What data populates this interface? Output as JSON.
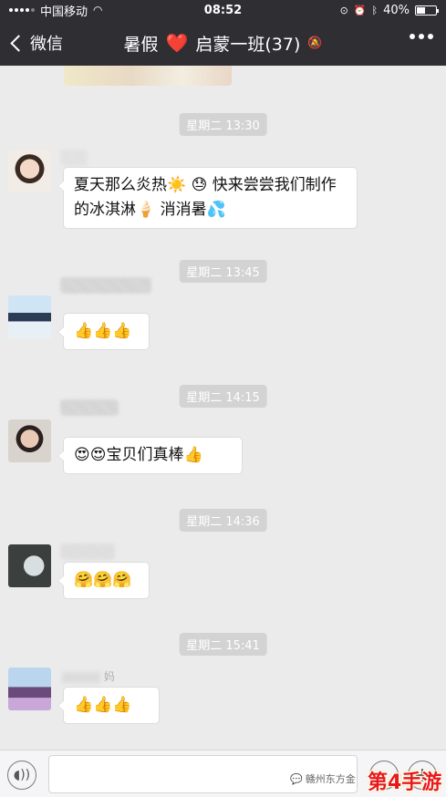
{
  "statusbar": {
    "carrier": "中国移动",
    "time": "08:52",
    "battery": "40%"
  },
  "nav": {
    "back_label": "微信",
    "title_left": "暑假",
    "title_heart": "❤️",
    "title_right": "启蒙一班(37)"
  },
  "messages": [
    {
      "timestamp": "星期二 13:30",
      "nickname": "",
      "text": "夏天那么炎热☀️ 😓 快来尝尝我们制作的冰淇淋🍦 消消暑💦"
    },
    {
      "timestamp": "星期二 13:45",
      "nickname": "",
      "text": "👍👍👍"
    },
    {
      "timestamp": "星期二 14:15",
      "nickname": "",
      "text": "😍😍宝贝们真棒👍"
    },
    {
      "timestamp": "星期二 14:36",
      "nickname": "",
      "text": "🤗🤗🤗"
    },
    {
      "timestamp": "星期二 15:41",
      "nickname": "妈",
      "text": "👍👍👍"
    }
  ],
  "watermark": {
    "source": "赣州东方金",
    "logo": "第4手游"
  },
  "colors": {
    "header_bg": "#2e2e33",
    "chat_bg": "#ebebeb",
    "heart": "#e02a33"
  }
}
